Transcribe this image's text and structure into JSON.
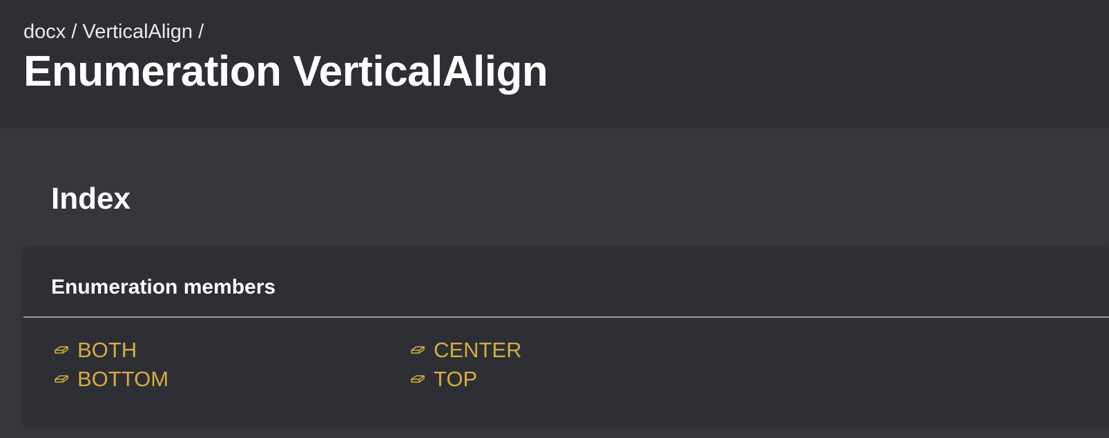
{
  "breadcrumb": {
    "items": [
      "docx",
      "VerticalAlign"
    ],
    "separator": "/"
  },
  "page_title": "Enumeration VerticalAlign",
  "index": {
    "title": "Index",
    "section_title": "Enumeration members",
    "members": [
      {
        "label": "BOTH",
        "icon": "enum-member-icon"
      },
      {
        "label": "CENTER",
        "icon": "enum-member-icon"
      },
      {
        "label": "BOTTOM",
        "icon": "enum-member-icon"
      },
      {
        "label": "TOP",
        "icon": "enum-member-icon"
      }
    ]
  },
  "colors": {
    "header_bg": "#2e2f35",
    "page_bg": "#36373d",
    "panel_bg": "#2e2f35",
    "link_accent": "#d4ad43",
    "text": "#ffffff"
  }
}
